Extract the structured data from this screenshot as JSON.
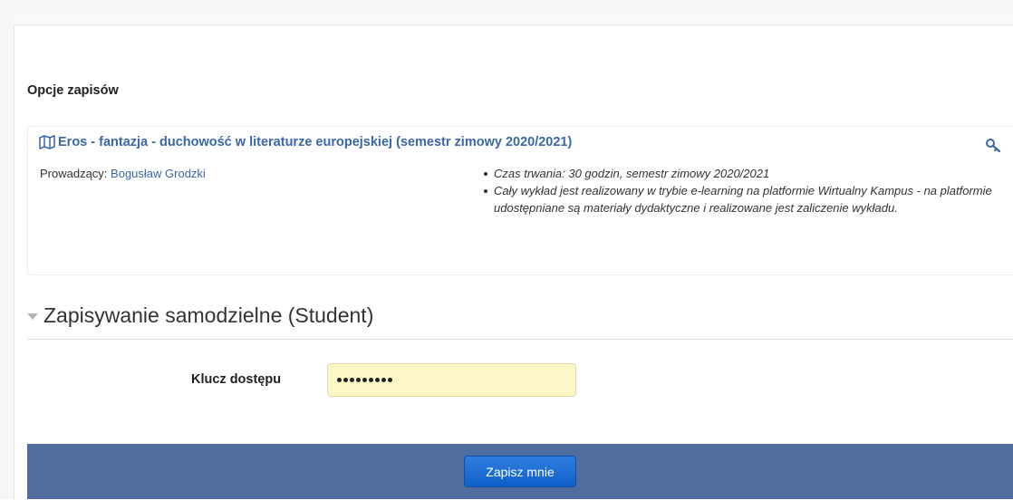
{
  "page": {
    "section_heading": "Opcje zapisów"
  },
  "course": {
    "title": "Eros - fantazja - duchowość w literaturze europejskiej (semestr zimowy 2020/2021)",
    "teacher_label": "Prowadzący:",
    "teacher_name": "Bogusław Grodzki",
    "summary": [
      "Czas trwania: 30 godzin, semestr zimowy 2020/2021",
      "Cały wykład jest realizowany w trybie e-learning na platformie Wirtualny Kampus - na platformie udostępniane są materiały dydaktyczne i realizowane jest zaliczenie wykładu."
    ],
    "icons": [
      "map-icon",
      "key-icon"
    ]
  },
  "enrol": {
    "legend": "Zapisywanie samodzielne (Student)",
    "key_label": "Klucz dostępu",
    "key_masked_length": 9,
    "submit_label": "Zapisz mnie"
  },
  "colors": {
    "link": "#3a67a8",
    "footer_bar": "#4f6e9f",
    "button": "#1a6ad6",
    "input_bg": "#fdf6c6"
  }
}
